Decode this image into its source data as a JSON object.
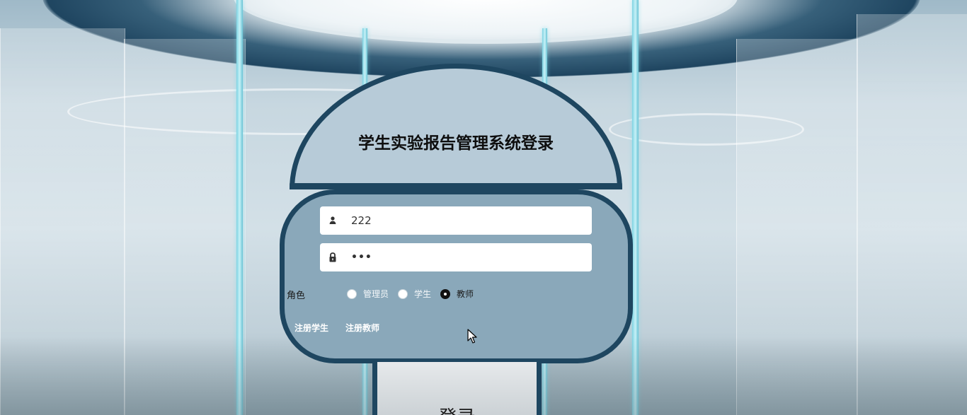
{
  "login": {
    "title": "学生实验报告管理系统登录",
    "username": {
      "value": "222",
      "icon": "user-icon"
    },
    "password": {
      "value": "•••",
      "icon": "lock-icon"
    },
    "role": {
      "label": "角色",
      "options": [
        {
          "label": "管理员",
          "checked": false
        },
        {
          "label": "学生",
          "checked": false
        },
        {
          "label": "教师",
          "checked": true
        }
      ]
    },
    "links": {
      "register_student": "注册学生",
      "register_teacher": "注册教师"
    },
    "submit_label": "登录"
  },
  "colors": {
    "frame": "#1e4660",
    "dome_fill": "#b7cbd8",
    "body_fill": "#8aa8ba"
  }
}
